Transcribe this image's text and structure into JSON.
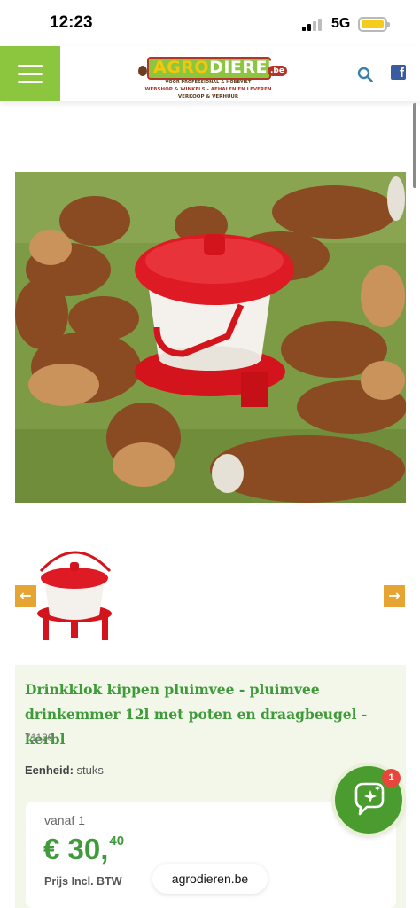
{
  "status_bar": {
    "time": "12:23",
    "network": "5G",
    "battery_color": "#f3cc1c"
  },
  "header": {
    "menu_icon": "hamburger-icon",
    "brand_color": "#8cc63f",
    "logo": {
      "name_part1": "AGRO",
      "name_part2": "DIEREN",
      "tld": ".be",
      "tagline1": "VOOR PROFESSIONAL & HOBBYIST",
      "tagline2": "WEBSHOP & WINKELS - AFHALEN EN LEVEREN",
      "tagline3": "VERKOOP & VERHUUR"
    },
    "search_icon": "search-icon",
    "facebook_icon": "facebook-icon",
    "facebook_letter": "f"
  },
  "gallery": {
    "main_image": "hens-around-red-drinker-photo",
    "thumbnail": "red-drinker-thumbnail",
    "prev_label": "←",
    "next_label": "→",
    "arrow_color": "#e6a532"
  },
  "product": {
    "title": "Drinkklok kippen pluimvee - pluimvee drinkemmer 12l met poten en draagbeugel - kerbl",
    "sku": "71120",
    "unit_label": "Eenheid:",
    "unit_value": "stuks",
    "price_from": "vanaf 1",
    "price_main": "€ 30,",
    "price_cents": "40",
    "price_note": "Prijs Incl. BTW",
    "accent_color": "#3f9a3a"
  },
  "browser": {
    "url": "agrodieren.be"
  },
  "chat": {
    "icon": "chat-sparkle-icon",
    "badge_count": "1"
  }
}
